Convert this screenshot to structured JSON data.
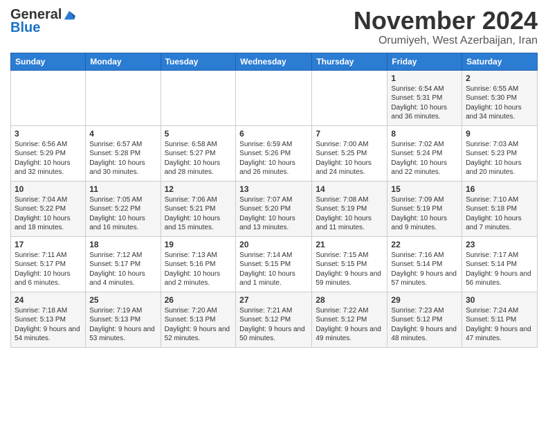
{
  "header": {
    "logo_general": "General",
    "logo_blue": "Blue",
    "month_title": "November 2024",
    "location": "Orumiyeh, West Azerbaijan, Iran"
  },
  "calendar": {
    "days_of_week": [
      "Sunday",
      "Monday",
      "Tuesday",
      "Wednesday",
      "Thursday",
      "Friday",
      "Saturday"
    ],
    "weeks": [
      [
        {
          "day": "",
          "info": ""
        },
        {
          "day": "",
          "info": ""
        },
        {
          "day": "",
          "info": ""
        },
        {
          "day": "",
          "info": ""
        },
        {
          "day": "",
          "info": ""
        },
        {
          "day": "1",
          "info": "Sunrise: 6:54 AM\nSunset: 5:31 PM\nDaylight: 10 hours and 36 minutes."
        },
        {
          "day": "2",
          "info": "Sunrise: 6:55 AM\nSunset: 5:30 PM\nDaylight: 10 hours and 34 minutes."
        }
      ],
      [
        {
          "day": "3",
          "info": "Sunrise: 6:56 AM\nSunset: 5:29 PM\nDaylight: 10 hours and 32 minutes."
        },
        {
          "day": "4",
          "info": "Sunrise: 6:57 AM\nSunset: 5:28 PM\nDaylight: 10 hours and 30 minutes."
        },
        {
          "day": "5",
          "info": "Sunrise: 6:58 AM\nSunset: 5:27 PM\nDaylight: 10 hours and 28 minutes."
        },
        {
          "day": "6",
          "info": "Sunrise: 6:59 AM\nSunset: 5:26 PM\nDaylight: 10 hours and 26 minutes."
        },
        {
          "day": "7",
          "info": "Sunrise: 7:00 AM\nSunset: 5:25 PM\nDaylight: 10 hours and 24 minutes."
        },
        {
          "day": "8",
          "info": "Sunrise: 7:02 AM\nSunset: 5:24 PM\nDaylight: 10 hours and 22 minutes."
        },
        {
          "day": "9",
          "info": "Sunrise: 7:03 AM\nSunset: 5:23 PM\nDaylight: 10 hours and 20 minutes."
        }
      ],
      [
        {
          "day": "10",
          "info": "Sunrise: 7:04 AM\nSunset: 5:22 PM\nDaylight: 10 hours and 18 minutes."
        },
        {
          "day": "11",
          "info": "Sunrise: 7:05 AM\nSunset: 5:22 PM\nDaylight: 10 hours and 16 minutes."
        },
        {
          "day": "12",
          "info": "Sunrise: 7:06 AM\nSunset: 5:21 PM\nDaylight: 10 hours and 15 minutes."
        },
        {
          "day": "13",
          "info": "Sunrise: 7:07 AM\nSunset: 5:20 PM\nDaylight: 10 hours and 13 minutes."
        },
        {
          "day": "14",
          "info": "Sunrise: 7:08 AM\nSunset: 5:19 PM\nDaylight: 10 hours and 11 minutes."
        },
        {
          "day": "15",
          "info": "Sunrise: 7:09 AM\nSunset: 5:19 PM\nDaylight: 10 hours and 9 minutes."
        },
        {
          "day": "16",
          "info": "Sunrise: 7:10 AM\nSunset: 5:18 PM\nDaylight: 10 hours and 7 minutes."
        }
      ],
      [
        {
          "day": "17",
          "info": "Sunrise: 7:11 AM\nSunset: 5:17 PM\nDaylight: 10 hours and 6 minutes."
        },
        {
          "day": "18",
          "info": "Sunrise: 7:12 AM\nSunset: 5:17 PM\nDaylight: 10 hours and 4 minutes."
        },
        {
          "day": "19",
          "info": "Sunrise: 7:13 AM\nSunset: 5:16 PM\nDaylight: 10 hours and 2 minutes."
        },
        {
          "day": "20",
          "info": "Sunrise: 7:14 AM\nSunset: 5:15 PM\nDaylight: 10 hours and 1 minute."
        },
        {
          "day": "21",
          "info": "Sunrise: 7:15 AM\nSunset: 5:15 PM\nDaylight: 9 hours and 59 minutes."
        },
        {
          "day": "22",
          "info": "Sunrise: 7:16 AM\nSunset: 5:14 PM\nDaylight: 9 hours and 57 minutes."
        },
        {
          "day": "23",
          "info": "Sunrise: 7:17 AM\nSunset: 5:14 PM\nDaylight: 9 hours and 56 minutes."
        }
      ],
      [
        {
          "day": "24",
          "info": "Sunrise: 7:18 AM\nSunset: 5:13 PM\nDaylight: 9 hours and 54 minutes."
        },
        {
          "day": "25",
          "info": "Sunrise: 7:19 AM\nSunset: 5:13 PM\nDaylight: 9 hours and 53 minutes."
        },
        {
          "day": "26",
          "info": "Sunrise: 7:20 AM\nSunset: 5:13 PM\nDaylight: 9 hours and 52 minutes."
        },
        {
          "day": "27",
          "info": "Sunrise: 7:21 AM\nSunset: 5:12 PM\nDaylight: 9 hours and 50 minutes."
        },
        {
          "day": "28",
          "info": "Sunrise: 7:22 AM\nSunset: 5:12 PM\nDaylight: 9 hours and 49 minutes."
        },
        {
          "day": "29",
          "info": "Sunrise: 7:23 AM\nSunset: 5:12 PM\nDaylight: 9 hours and 48 minutes."
        },
        {
          "day": "30",
          "info": "Sunrise: 7:24 AM\nSunset: 5:11 PM\nDaylight: 9 hours and 47 minutes."
        }
      ]
    ]
  }
}
